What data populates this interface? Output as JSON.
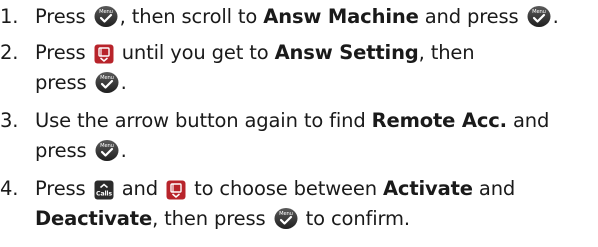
{
  "steps": [
    {
      "number": "1.",
      "line1": {
        "t1": "Press",
        "t2": ", then scroll to",
        "b1": "Answ Machine",
        "t3": "and press",
        "t4": "."
      }
    },
    {
      "number": "2.",
      "line1": {
        "t1": "Press",
        "t2": "until you get to",
        "b1": "Answ Setting",
        "t3": ", then"
      },
      "line2": {
        "t1": "press",
        "t2": "."
      }
    },
    {
      "number": "3.",
      "line1": {
        "t1": "Use the arrow button again to find",
        "b1": "Remote Acc.",
        "t2": "and"
      },
      "line2": {
        "t1": "press",
        "t2": "."
      }
    },
    {
      "number": "4.",
      "line1": {
        "t1": "Press",
        "t2": "and",
        "t3": "to choose between",
        "b1": "Activate",
        "t4": "and"
      },
      "line2": {
        "b1": "Deactivate",
        "t1": ", then press",
        "t2": "to confirm."
      }
    }
  ],
  "icons": {
    "menu_label": "Menu",
    "calls_label": "Calls",
    "menu_icon": "menu-ok-button-icon",
    "calls_icon": "calls-up-button-icon",
    "phonebook_icon": "phonebook-down-button-icon"
  },
  "colors": {
    "text": "#1a1a1a",
    "icon_dark": "#2b2b2b",
    "icon_red": "#c0262d"
  }
}
